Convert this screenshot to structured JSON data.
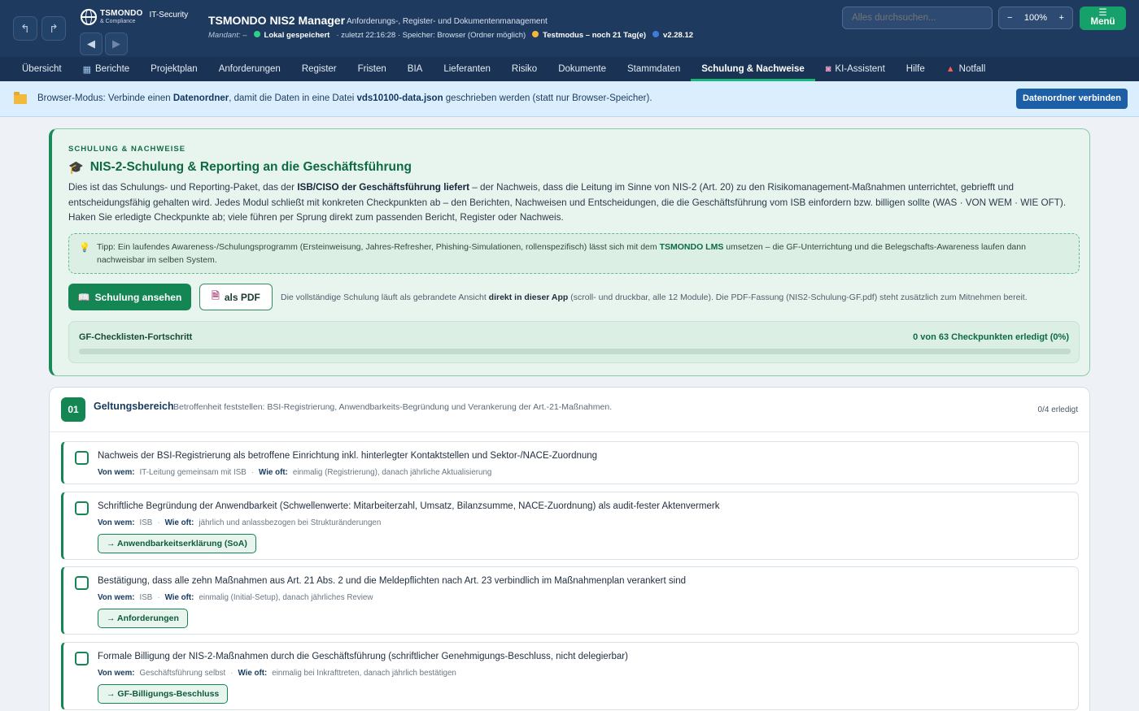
{
  "header": {
    "logo_name": "TSMONDO",
    "logo_sub": "& Compliance",
    "logo_it": "IT-Security",
    "app_title": "TSMONDO NIS2 Manager",
    "app_subtitle": "Anforderungs-, Register- und Dokumentenmanagement",
    "mandant": "Mandant: –",
    "storage_status": "Lokal gespeichert",
    "last_saved": "· zuletzt 22:16:28 · Speicher: Browser (Ordner möglich)",
    "test_mode": "Testmodus – noch 21 Tag(e)",
    "version": "v2.28.12",
    "search_placeholder": "Alles durchsuchen...",
    "zoom_minus": "−",
    "zoom_level": "100%",
    "zoom_plus": "+",
    "menu_icon": "☰",
    "menu_label": "Menü",
    "status_colors": {
      "saved": "#2fd08a",
      "test": "#f5b83d",
      "version": "#3b7dd8"
    }
  },
  "nav": {
    "tabs": [
      {
        "label": "Übersicht",
        "icon": ""
      },
      {
        "label": "Berichte",
        "icon": "chart-icon"
      },
      {
        "label": "Projektplan",
        "icon": ""
      },
      {
        "label": "Anforderungen",
        "icon": ""
      },
      {
        "label": "Register",
        "icon": ""
      },
      {
        "label": "Fristen",
        "icon": ""
      },
      {
        "label": "BIA",
        "icon": ""
      },
      {
        "label": "Lieferanten",
        "icon": ""
      },
      {
        "label": "Risiko",
        "icon": ""
      },
      {
        "label": "Dokumente",
        "icon": ""
      },
      {
        "label": "Stammdaten",
        "icon": ""
      },
      {
        "label": "Schulung & Nachweise",
        "icon": "",
        "active": true
      },
      {
        "label": "KI-Assistent",
        "icon": "robot-icon"
      },
      {
        "label": "Hilfe",
        "icon": ""
      },
      {
        "label": "Notfall",
        "icon": "siren-icon"
      }
    ]
  },
  "banner": {
    "pre": "Browser-Modus: Verbinde einen ",
    "strong1": "Datenordner",
    "mid": ", damit die Daten in eine Datei ",
    "strong2": "vds10100-data.json",
    "post": " geschrieben werden (statt nur Browser-Speicher).",
    "button": "Datenordner verbinden"
  },
  "intro": {
    "kicker": "SCHULUNG & NACHWEISE",
    "title": "NIS-2-Schulung & Reporting an die Geschäftsführung",
    "body_1": "Dies ist das Schulungs- und Reporting-Paket, das der ",
    "body_strong": "ISB/CISO der Geschäftsführung liefert",
    "body_2": " – der Nachweis, dass die Leitung im Sinne von NIS-2 (Art. 20) zu den Risikomanagement-Maßnahmen unterrichtet, gebriefft und entscheidungsfähig gehalten wird. Jedes Modul schließt mit konkreten Checkpunkten ab – den Berichten, Nachweisen und Entscheidungen, die die Geschäftsführung vom ISB einfordern bzw. billigen sollte (WAS · VON WEM · WIE OFT). Haken Sie erledigte Checkpunkte ab; viele führen per Sprung direkt zum passenden Bericht, Register oder Nachweis.",
    "tip_1": "Tipp: Ein laufendes Awareness-/Schulungsprogramm (Ersteinweisung, Jahres-Refresher, Phishing-Simulationen, rollenspezifisch) lässt sich mit dem ",
    "tip_strong": "TSMONDO LMS",
    "tip_2": " umsetzen – die GF-Unterrichtung und die Belegschafts-Awareness laufen dann nachweisbar im selben System.",
    "btn_view": "Schulung ansehen",
    "btn_pdf": "als PDF",
    "note_1": "Die vollständige Schulung läuft als gebrandete Ansicht ",
    "note_strong": "direkt in dieser App",
    "note_2": " (scroll- und druckbar, alle 12 Module). Die PDF-Fassung (NIS2-Schulung-GF.pdf) steht zusätzlich zum Mitnehmen bereit.",
    "progress_label": "GF-Checklisten-Fortschritt",
    "progress_count": "0 von 63 Checkpunkten erledigt (0%)",
    "progress_fraction": 0
  },
  "module": {
    "number": "01",
    "title": "Geltungsbereich",
    "description": "Betroffenheit feststellen: BSI-Registrierung, Anwendbarkeits-Begründung und Verankerung der Art.-21-Maßnahmen.",
    "count": "0/4 erledigt",
    "from_label": "Von wem:",
    "freq_label": "Wie oft:",
    "items": [
      {
        "text": "Nachweis der BSI-Registrierung als betroffene Einrichtung inkl. hinterlegter Kontaktstellen und Sektor-/NACE-Zuordnung",
        "from": "IT-Leitung gemeinsam mit ISB",
        "freq": "einmalig (Registrierung), danach jährliche Aktualisierung",
        "link": ""
      },
      {
        "text": "Schriftliche Begründung der Anwendbarkeit (Schwellenwerte: Mitarbeiterzahl, Umsatz, Bilanzsumme, NACE-Zuordnung) als audit-fester Aktenvermerk",
        "from": "ISB",
        "freq": "jährlich und anlassbezogen bei Strukturänderungen",
        "link": "→ Anwendbarkeitserklärung (SoA)"
      },
      {
        "text": "Bestätigung, dass alle zehn Maßnahmen aus Art. 21 Abs. 2 und die Meldepflichten nach Art. 23 verbindlich im Maßnahmenplan verankert sind",
        "from": "ISB",
        "freq": "einmalig (Initial-Setup), danach jährliches Review",
        "link": "→ Anforderungen"
      },
      {
        "text": "Formale Billigung der NIS-2-Maßnahmen durch die Geschäftsführung (schriftlicher Genehmigungs-Beschluss, nicht delegierbar)",
        "from": "Geschäftsführung selbst",
        "freq": "einmalig bei Inkrafttreten, danach jährlich bestätigen",
        "link": "→ GF-Billigungs-Beschluss"
      }
    ]
  }
}
